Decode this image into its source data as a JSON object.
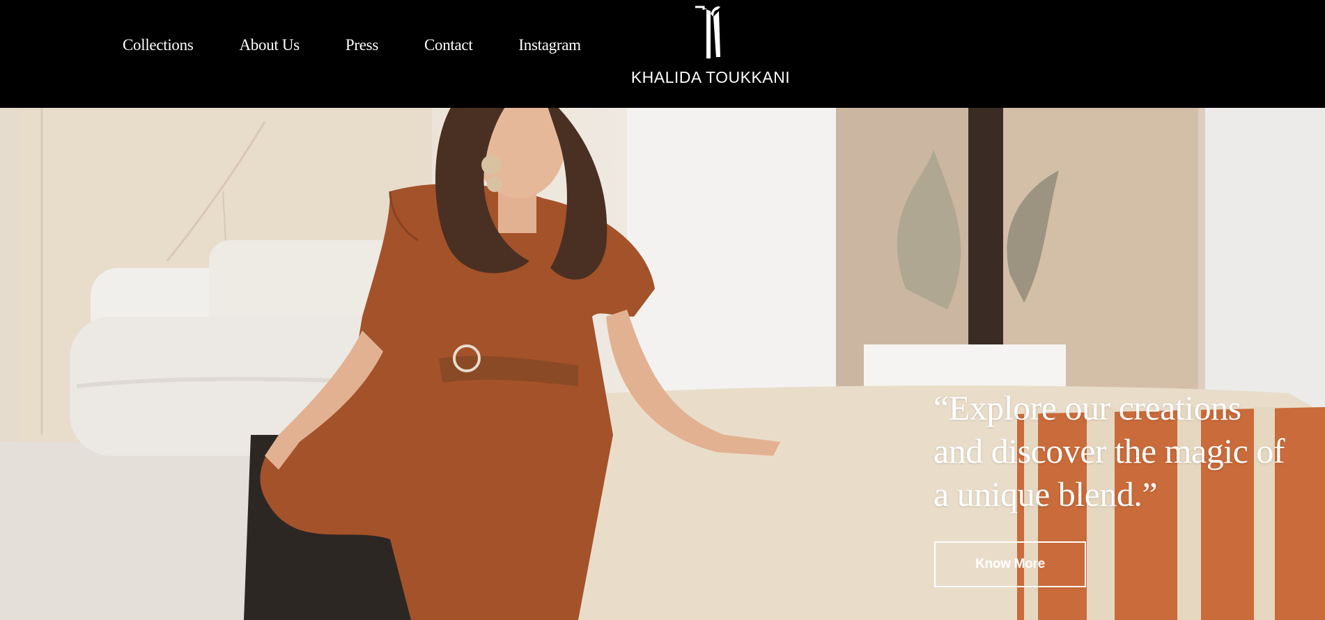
{
  "nav": {
    "items": [
      {
        "label": "Collections"
      },
      {
        "label": "About Us"
      },
      {
        "label": "Press"
      },
      {
        "label": "Contact"
      },
      {
        "label": "Instagram"
      }
    ]
  },
  "brand": {
    "name": "KHALIDA TOUKKANI",
    "logo_icon": "kt-monogram-icon"
  },
  "hero": {
    "quote": "“Explore our creations and discover the magic of a unique blend.”",
    "cta_label": "Know More",
    "image": "woman-seated-on-pouf-photo"
  },
  "colors": {
    "header_bg": "#000000",
    "text": "#ffffff",
    "rust": "#a4522a"
  }
}
